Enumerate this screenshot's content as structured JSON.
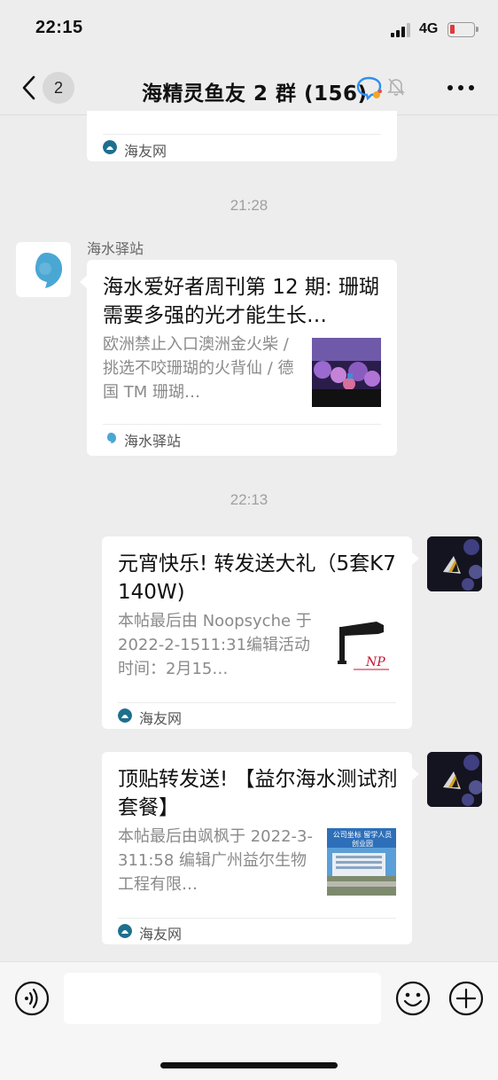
{
  "status_bar": {
    "time": "22:15",
    "network": "4G"
  },
  "nav": {
    "unread_count": "2",
    "title": "海精灵鱼友 2 群 (156)"
  },
  "messages": [
    {
      "source": "海友网"
    },
    {
      "time": "21:28"
    },
    {
      "sender": "海水驿站",
      "title": "海水爱好者周刊第 12 期: 珊瑚需要多强的光才能生长…",
      "desc": "欧洲禁止入口澳洲金火柴 / 挑选不咬珊瑚的火背仙 / 德国 TM 珊瑚…",
      "source": "海水驿站"
    },
    {
      "time": "22:13"
    },
    {
      "title": "元宵快乐! 转发送大礼（5套K7  140W)",
      "desc": "本帖最后由 Noopsyche 于 2022-2-1511:31编辑活动时间：2月15…",
      "source": "海友网"
    },
    {
      "title": "顶贴转发送! 【益尔海水测试剂套餐】",
      "desc": "本帖最后由飒枫于 2022-3-311:58 编辑广州益尔生物工程有限…",
      "source": "海友网",
      "thumb_text": "公司坐标 留学人员创业园"
    }
  ],
  "colors": {
    "background": "#ededed",
    "card": "#ffffff",
    "source_icon": "#1e6f8e",
    "sea_icon": "#4aa7d4",
    "battery_low": "#e03a3a"
  }
}
